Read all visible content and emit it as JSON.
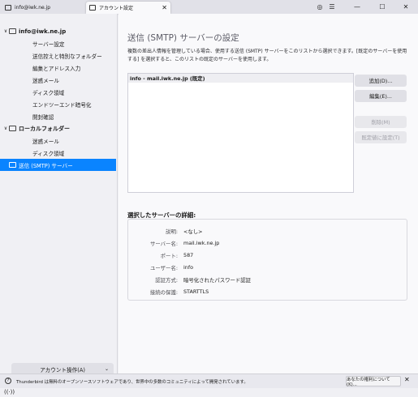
{
  "tabs": [
    {
      "label": "info@iwk.ne.jp"
    },
    {
      "label": "アカウント設定",
      "close": "✕"
    }
  ],
  "window_controls": {
    "minimize": "—",
    "maximize": "☐",
    "close": "✕",
    "ring": "◎",
    "menu": "☰"
  },
  "sidebar": {
    "items": [
      {
        "label": "info@iwk.ne.jp",
        "chevron": "∨"
      },
      {
        "label": "サーバー設定"
      },
      {
        "label": "送信控えと特別なフォルダー"
      },
      {
        "label": "編集とアドレス入力"
      },
      {
        "label": "迷惑メール"
      },
      {
        "label": "ディスク領域"
      },
      {
        "label": "エンドツーエンド暗号化"
      },
      {
        "label": "開封確認"
      },
      {
        "label": "ローカルフォルダー",
        "chevron": "∨"
      },
      {
        "label": "迷惑メール"
      },
      {
        "label": "ディスク領域"
      },
      {
        "label": "送信 (SMTP) サーバー"
      }
    ],
    "account_actions": "アカウント操作(A)",
    "account_actions_chevron": "⌄"
  },
  "main": {
    "title": "送信 (SMTP) サーバーの設定",
    "description": "複数の差出人情報を管理している場合、使用する送信 (SMTP) サーバーをこのリストから選択できます。[既定のサーバーを使用する] を選択すると、このリストの既定のサーバーを使用します。",
    "servers": [
      "info - mail.iwk.ne.jp (既定)"
    ],
    "buttons": {
      "add": "追加(D)...",
      "edit": "編集(E)...",
      "remove": "削除(M)",
      "set_default": "既定値に設定(T)"
    },
    "details_heading": "選択したサーバーの詳細:",
    "details": [
      {
        "label": "説明:",
        "value": "<なし>"
      },
      {
        "label": "サーバー名:",
        "value": "mail.iwk.ne.jp"
      },
      {
        "label": "ポート:",
        "value": "587"
      },
      {
        "label": "ユーザー名:",
        "value": "info"
      },
      {
        "label": "認証方式:",
        "value": "暗号化されたパスワード認証"
      },
      {
        "label": "接続の保護:",
        "value": "STARTTLS"
      }
    ]
  },
  "notification": {
    "icon": "?",
    "text": "Thunderbird は無料のオープンソースソフトウェアであり、世界中の多数のコミュニティによって開発されています。",
    "rights_button": "あなたの権利について(K)...",
    "close": "✕"
  },
  "statusbar": {
    "activity_icon": "((·))"
  }
}
